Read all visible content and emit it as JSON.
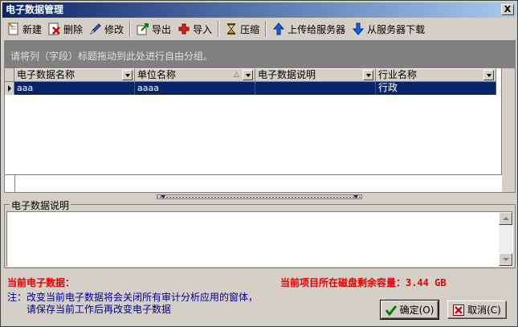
{
  "window": {
    "title": "电子数据管理",
    "close_label": "X"
  },
  "toolbar": {
    "new_label": "新建",
    "delete_label": "删除",
    "edit_label": "修改",
    "export_label": "导出",
    "import_label": "导入",
    "compress_label": "压缩",
    "upload_label": "上传给服务器",
    "download_label": "从服务器下载"
  },
  "group_bar": {
    "hint": "请将列（字段）标题拖动到此处进行自由分组。"
  },
  "grid": {
    "columns": [
      {
        "label": "电子数据名称"
      },
      {
        "label": "单位名称",
        "sort": "△"
      },
      {
        "label": "电子数据说明"
      },
      {
        "label": "行业名称"
      }
    ],
    "rows": [
      {
        "cells": [
          "aaa",
          "aaaa",
          "",
          "行政"
        ]
      }
    ]
  },
  "description": {
    "label": "电子数据说明",
    "value": ""
  },
  "status": {
    "current_data_label": "当前电子数据：",
    "disk_label": "当前项目所在磁盘剩余容量：3.44 GB"
  },
  "note": {
    "line1": "注：改变当前电子数据将会关闭所有审计分析应用的窗体，",
    "line2": "请保存当前工作后再改变电子数据"
  },
  "buttons": {
    "ok_label": "确定(O)",
    "cancel_label": "取消(C)"
  },
  "colors": {
    "title_bar": "#0a246a",
    "selection": "#0a246a",
    "group_bar": "#808080",
    "warning_text": "#e00000",
    "note_text": "#00008b"
  }
}
